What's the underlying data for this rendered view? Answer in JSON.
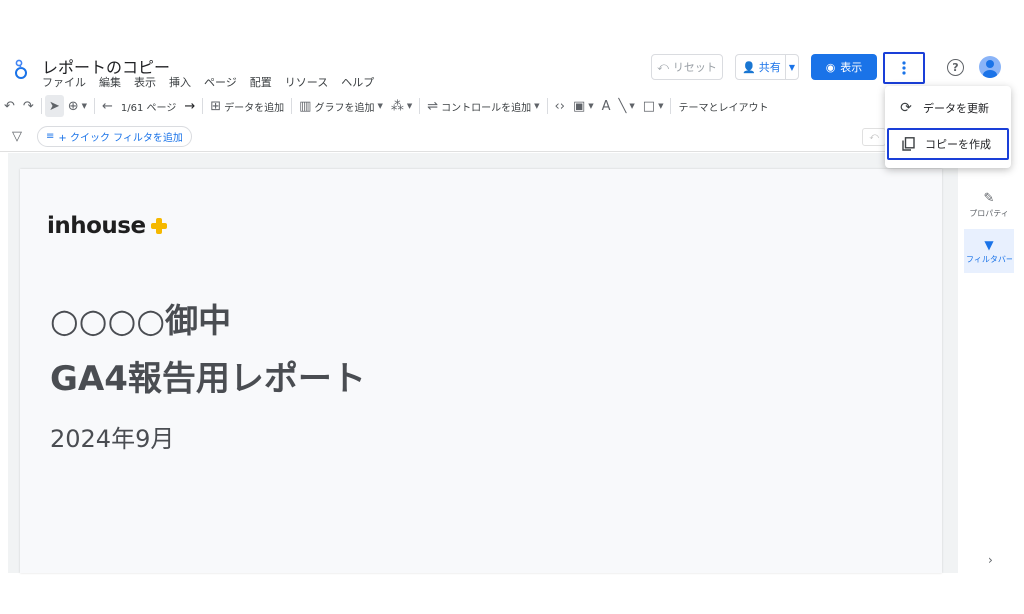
{
  "header": {
    "title": "レポートのコピー",
    "menu": [
      "ファイル",
      "編集",
      "表示",
      "挿入",
      "ページ",
      "配置",
      "リソース",
      "ヘルプ"
    ],
    "reset_label": "リセット",
    "share_label": "共有",
    "view_label": "表示"
  },
  "toolbar": {
    "page_indicator": "1/61 ページ",
    "add_data": "データを追加",
    "add_chart": "グラフを追加",
    "add_control": "コントロールを追加",
    "theme_layout": "テーマとレイアウト"
  },
  "filterbar": {
    "quick_filter": "+ クイック フィルタを追加"
  },
  "report": {
    "brand": "inhouse",
    "client": "○○○○御中",
    "title": "GA4報告用レポート",
    "date": "2024年9月"
  },
  "right_rail": {
    "properties": "プロパティ",
    "filter_bar": "フィルタバー"
  },
  "more_menu": {
    "items": [
      {
        "label": "データを更新",
        "icon": "refresh-icon"
      },
      {
        "label": "コピーを作成",
        "icon": "copy-icon"
      }
    ]
  },
  "colors": {
    "accent": "#1a73e8",
    "highlight_border": "#1a3fd8",
    "brand_plus": "#f5b800"
  }
}
